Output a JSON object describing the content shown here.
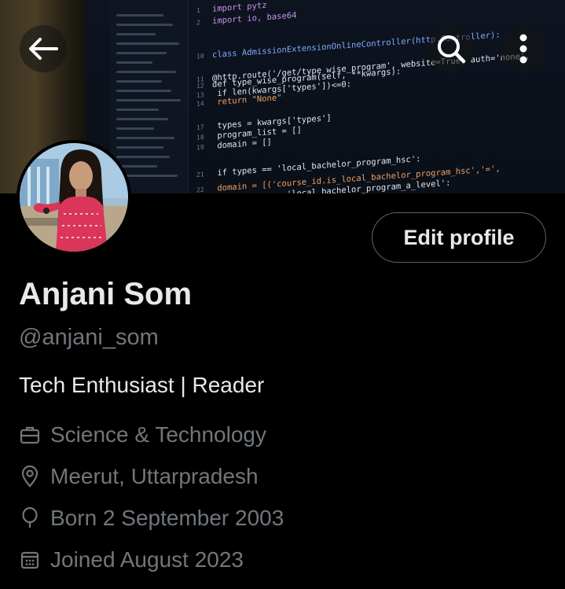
{
  "header": {
    "back_icon": "arrow-left-icon",
    "search_icon": "search-icon",
    "more_icon": "more-vertical-icon"
  },
  "banner": {
    "code_lines": [
      {
        "num": "1",
        "text": "import pytz"
      },
      {
        "num": "2",
        "text": "import io, base64"
      },
      {
        "num": "10",
        "text": "class AdmissionExtensionOnlineController(http.Controller):"
      },
      {
        "num": "11",
        "text": "@http.route('/get/type_wise_program', website=True, auth='none',"
      },
      {
        "num": "12",
        "text": "def type_wise_program(self, **kwargs):"
      },
      {
        "num": "13",
        "text": "    if len(kwargs['types'])<=0:"
      },
      {
        "num": "14",
        "text": "        return \"None\""
      },
      {
        "num": "17",
        "text": "    types = kwargs['types']"
      },
      {
        "num": "18",
        "text": "    program_list = []"
      },
      {
        "num": "19",
        "text": "    domain = []"
      },
      {
        "num": "21",
        "text": "    if types == 'local_bachelor_program_hsc':"
      },
      {
        "num": "22",
        "text": "        domain = [('course_id.is_local_bachelor_program_hsc','=',"
      },
      {
        "num": "23",
        "text": "    elif types == 'local_bachelor_program_a_level':"
      }
    ]
  },
  "profile": {
    "name": "Anjani Som",
    "handle": "@anjani_som",
    "bio": "Tech Enthusiast | Reader",
    "edit_button": "Edit profile",
    "category": "Science & Technology",
    "location": "Meerut, Uttarpradesh",
    "birthday": "Born 2 September 2003",
    "joined": "Joined August 2023"
  },
  "colors": {
    "background": "#000000",
    "text_primary": "#e7e9ea",
    "text_secondary": "#71767b",
    "border": "#536471"
  }
}
